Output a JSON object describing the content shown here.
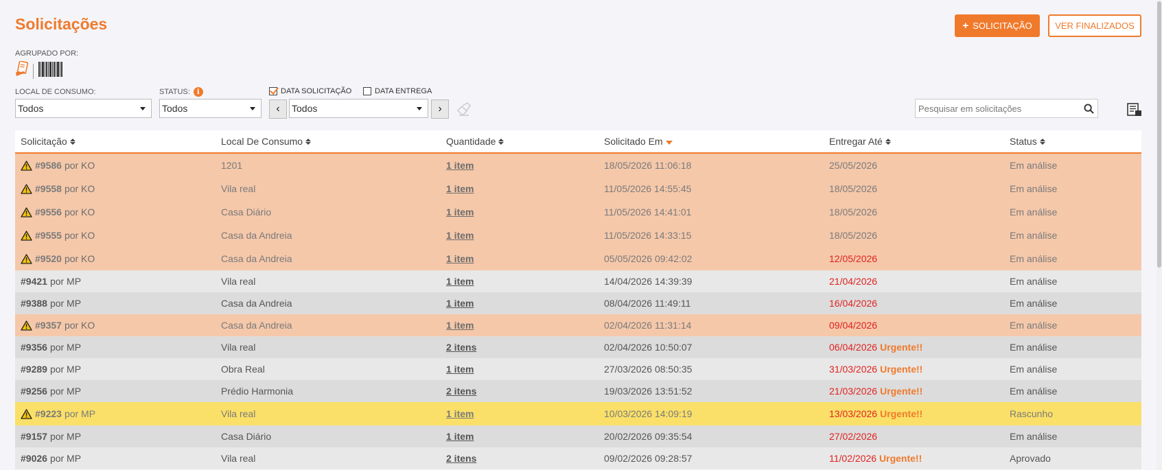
{
  "page": {
    "title": "Solicitações"
  },
  "actions": {
    "new_label": "SOLICITAÇÃO",
    "new_plus": "+",
    "finished_label": "VER FINALIZADOS"
  },
  "grouping": {
    "label": "AGRUPADO POR:",
    "icons": [
      "request-group-icon",
      "barcode-icon"
    ]
  },
  "filters": {
    "local_label": "LOCAL DE CONSUMO:",
    "local_value": "Todos",
    "status_label": "STATUS:",
    "status_value": "Todos",
    "date_request_label": "DATA SOLICITAÇÃO",
    "date_request_checked": true,
    "date_delivery_label": "DATA ENTREGA",
    "date_delivery_checked": false,
    "period_value": "Todos",
    "prev_glyph": "‹",
    "next_glyph": "›"
  },
  "search": {
    "placeholder": "Pesquisar em solicitações"
  },
  "table": {
    "columns": [
      "Solicitação",
      "Local De Consumo",
      "Quantidade",
      "Solicitado Em",
      "Entregar Até",
      "Status"
    ],
    "sort_column": "Solicitado Em",
    "rows": [
      {
        "id": "#9586",
        "by": "por KO",
        "local": "1201",
        "qty": "1 item",
        "requested": "18/05/2026 11:06:18",
        "deliver": "25/05/2026",
        "urgent": "",
        "status": "Em análise",
        "warn": true,
        "style": "orange",
        "late": false
      },
      {
        "id": "#9558",
        "by": "por KO",
        "local": "Vila real",
        "qty": "1 item",
        "requested": "11/05/2026 14:55:45",
        "deliver": "18/05/2026",
        "urgent": "",
        "status": "Em análise",
        "warn": true,
        "style": "orange",
        "late": false
      },
      {
        "id": "#9556",
        "by": "por KO",
        "local": "Casa Diário",
        "qty": "1 item",
        "requested": "11/05/2026 14:41:01",
        "deliver": "18/05/2026",
        "urgent": "",
        "status": "Em análise",
        "warn": true,
        "style": "orange",
        "late": false
      },
      {
        "id": "#9555",
        "by": "por KO",
        "local": "Casa da Andreia",
        "qty": "1 item",
        "requested": "11/05/2026 14:33:15",
        "deliver": "18/05/2026",
        "urgent": "",
        "status": "Em análise",
        "warn": true,
        "style": "orange",
        "late": false
      },
      {
        "id": "#9520",
        "by": "por KO",
        "local": "Casa da Andreia",
        "qty": "1 item",
        "requested": "05/05/2026 09:42:02",
        "deliver": "12/05/2026",
        "urgent": "",
        "status": "Em análise",
        "warn": true,
        "style": "orange",
        "late": true
      },
      {
        "id": "#9421",
        "by": "por MP",
        "local": "Vila real",
        "qty": "1 item",
        "requested": "14/04/2026 14:39:39",
        "deliver": "21/04/2026",
        "urgent": "",
        "status": "Em análise",
        "warn": false,
        "style": "gray1",
        "late": true
      },
      {
        "id": "#9388",
        "by": "por MP",
        "local": "Casa da Andreia",
        "qty": "1 item",
        "requested": "08/04/2026 11:49:11",
        "deliver": "16/04/2026",
        "urgent": "",
        "status": "Em análise",
        "warn": false,
        "style": "gray2",
        "late": true
      },
      {
        "id": "#9357",
        "by": "por KO",
        "local": "Casa da Andreia",
        "qty": "1 item",
        "requested": "02/04/2026 11:31:14",
        "deliver": "09/04/2026",
        "urgent": "",
        "status": "Em análise",
        "warn": true,
        "style": "orange short",
        "late": true
      },
      {
        "id": "#9356",
        "by": "por MP",
        "local": "Vila real",
        "qty": "2 itens",
        "requested": "02/04/2026 10:50:07",
        "deliver": "06/04/2026",
        "urgent": "Urgente!!",
        "status": "Em análise",
        "warn": false,
        "style": "gray2",
        "late": true
      },
      {
        "id": "#9289",
        "by": "por MP",
        "local": "Obra Real",
        "qty": "1 item",
        "requested": "27/03/2026 08:50:35",
        "deliver": "31/03/2026",
        "urgent": "Urgente!!",
        "status": "Em análise",
        "warn": false,
        "style": "gray1",
        "late": true
      },
      {
        "id": "#9256",
        "by": "por MP",
        "local": "Prédio Harmonia",
        "qty": "2 itens",
        "requested": "19/03/2026 13:51:52",
        "deliver": "21/03/2026",
        "urgent": "Urgente!!",
        "status": "Em análise",
        "warn": false,
        "style": "gray2",
        "late": true
      },
      {
        "id": "#9223",
        "by": "por MP",
        "local": "Vila real",
        "qty": "1 item",
        "requested": "10/03/2026 14:09:19",
        "deliver": "13/03/2026",
        "urgent": "Urgente!!",
        "status": "Rascunho",
        "warn": true,
        "style": "yellow",
        "late": true
      },
      {
        "id": "#9157",
        "by": "por MP",
        "local": "Casa Diário",
        "qty": "1 item",
        "requested": "20/02/2026 09:35:54",
        "deliver": "27/02/2026",
        "urgent": "",
        "status": "Em análise",
        "warn": false,
        "style": "gray2",
        "late": true
      },
      {
        "id": "#9026",
        "by": "por MP",
        "local": "Vila real",
        "qty": "2 itens",
        "requested": "09/02/2026 09:28:57",
        "deliver": "11/02/2026",
        "urgent": "Urgente!!",
        "status": "Aprovado",
        "warn": false,
        "style": "gray1",
        "late": true
      }
    ]
  },
  "colors": {
    "accent": "#f07a2c",
    "late": "#e0221f",
    "row_orange": "#f5c8aa",
    "row_yellow": "#fae068",
    "row_gray": "#e8e8e8"
  }
}
